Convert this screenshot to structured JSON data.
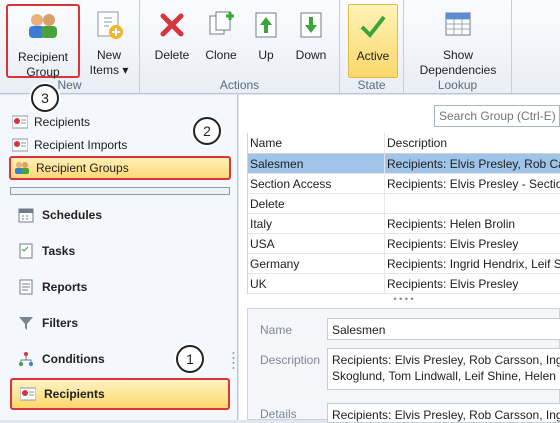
{
  "ribbon": {
    "groups": {
      "new": "New",
      "actions": "Actions",
      "state": "State",
      "lookup": "Lookup"
    },
    "buttons": {
      "recipient_group_line1": "Recipient",
      "recipient_group_line2": "Group",
      "new_items_line1": "New",
      "new_items_line2": "Items ▾",
      "delete": "Delete",
      "clone": "Clone",
      "up": "Up",
      "down": "Down",
      "active": "Active",
      "show_deps_line1": "Show",
      "show_deps_line2": "Dependencies"
    }
  },
  "callouts": [
    "1",
    "2",
    "3"
  ],
  "tree": {
    "items": [
      {
        "label": "Recipients",
        "icon": "recipients-icon"
      },
      {
        "label": "Recipient Imports",
        "icon": "recipient-imports-icon"
      },
      {
        "label": "Recipient Groups",
        "icon": "recipient-groups-icon"
      }
    ]
  },
  "nav": {
    "items": [
      {
        "label": "Schedules",
        "icon": "schedules-icon"
      },
      {
        "label": "Tasks",
        "icon": "tasks-icon"
      },
      {
        "label": "Reports",
        "icon": "reports-icon"
      },
      {
        "label": "Filters",
        "icon": "filters-icon"
      },
      {
        "label": "Conditions",
        "icon": "conditions-icon"
      },
      {
        "label": "Recipients",
        "icon": "recipients-icon"
      }
    ]
  },
  "search": {
    "placeholder": "Search Group (Ctrl-E)"
  },
  "grid": {
    "columns": [
      "Name",
      "Description"
    ],
    "rows": [
      {
        "name": "Salesmen",
        "description": "Recipients: Elvis Presley, Rob Carsson"
      },
      {
        "name": "Section Access",
        "description": "Recipients: Elvis Presley - Section"
      },
      {
        "name": "Delete",
        "description": ""
      },
      {
        "name": "Italy",
        "description": "Recipients: Helen Brolin"
      },
      {
        "name": "USA",
        "description": "Recipients: Elvis Presley"
      },
      {
        "name": "Germany",
        "description": "Recipients: Ingrid Hendrix, Leif Sh"
      },
      {
        "name": "UK",
        "description": "Recipients: Elvis Presley"
      }
    ]
  },
  "details": {
    "name_label": "Name",
    "name_value": "Salesmen",
    "description_label": "Description",
    "description_line1": "Recipients: Elvis Presley, Rob Carsson, Ingric",
    "description_line2": "Skoglund, Tom Lindwall, Leif Shine, Helen B",
    "details_label": "Details",
    "details_value": "Recipients: Elvis Presley, Rob Carsson, Ingric"
  }
}
